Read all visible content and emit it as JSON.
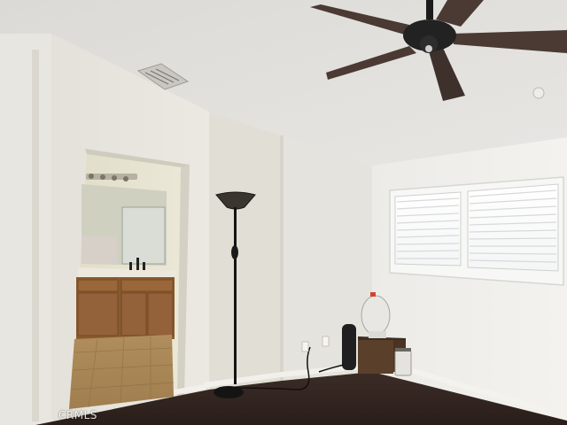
{
  "watermark": {
    "text": "CRMLS"
  }
}
